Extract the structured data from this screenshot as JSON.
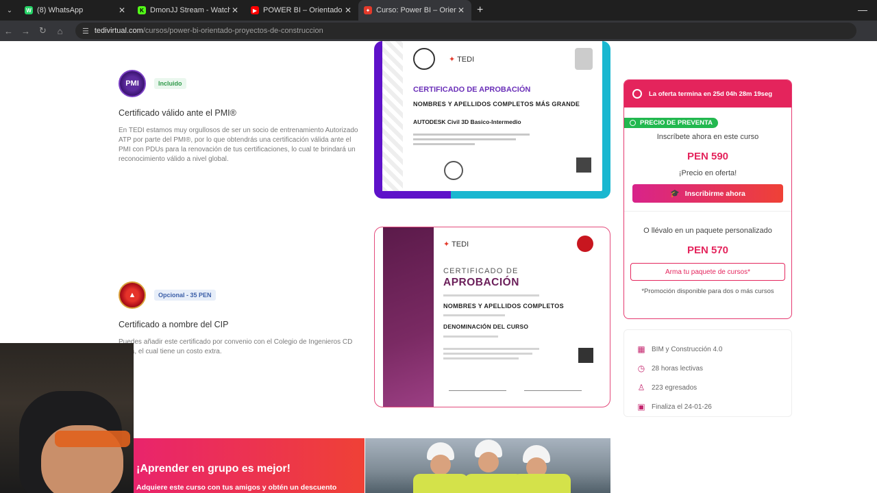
{
  "browser": {
    "tabs": [
      {
        "title": "(8) WhatsApp",
        "color": "#25d366",
        "glyph": "W"
      },
      {
        "title": "DmonJJ Stream - Watch Live on",
        "color": "#53fc18",
        "glyph": "K"
      },
      {
        "title": "POWER BI – Orientado a proyec",
        "color": "#ff0000",
        "glyph": "▶"
      },
      {
        "title": "Curso: Power BI – Orientado a p",
        "color": "#e33a2b",
        "glyph": "✦"
      }
    ],
    "url_domain": "tedivirtual.com",
    "url_path": "/cursos/power-bi-orientado-proyectos-de-construccion"
  },
  "sections": {
    "pmi": {
      "badge": "Incluido",
      "title": "Certificado válido ante el PMI®",
      "text": "En TEDI estamos muy orgullosos de ser un socio de entrenamiento Autorizado ATP por parte del PMI®, por lo que obtendrás una certificación válida ante el PMI con PDUs para la renovación de tus certificaciones, lo cual te brindará un reconocimiento válido a nivel global."
    },
    "cip": {
      "badge": "Opcional - 35 PEN",
      "title": "Certificado a nombre del CIP",
      "text": "Puedes añadir este certificado por convenio con el Colegio de Ingenieros CD Piura, el cual tiene un costo extra."
    }
  },
  "cert1": {
    "tedi": "TEDI",
    "heading": "CERTIFICADO DE APROBACIÓN",
    "name": "NOMBRES Y APELLIDOS COMPLETOS MÁS GRANDE",
    "course": "AUTODESK Civil 3D Basico-Intermedio"
  },
  "cert2": {
    "tedi": "TEDI",
    "heading1": "CERTIFICADO DE",
    "heading2": "APROBACIÓN",
    "name": "NOMBRES Y APELLIDOS COMPLETOS",
    "course": "DENOMINACIÓN DEL CURSO"
  },
  "offer": {
    "countdown": "La oferta termina en 25d 04h 28m 19seg",
    "presale": "PRECIO DE PREVENTA",
    "enroll_text": "Inscríbete ahora en este curso",
    "price": "PEN 590",
    "offer_text": "¡Precio en oferta!",
    "enroll_button": "Inscribirme ahora",
    "package_text": "O llévalo en un paquete personalizado",
    "package_price": "PEN 570",
    "package_button": "Arma tu paquete de cursos*",
    "promo_note": "*Promoción disponible para dos o más cursos"
  },
  "info": {
    "items": [
      {
        "icon": "building-icon",
        "label": "BIM y Construcción 4.0"
      },
      {
        "icon": "clock-icon",
        "label": "28 horas lectivas"
      },
      {
        "icon": "graduate-icon",
        "label": "223 egresados"
      },
      {
        "icon": "calendar-icon",
        "label": "Finaliza el 24-01-26"
      }
    ]
  },
  "banner": {
    "title": "¡Aprender en grupo es mejor!",
    "subtitle": "Adquiere este curso con tus amigos y obtén un descuento"
  },
  "colors": {
    "accent": "#e4245c",
    "presale_green": "#22b84f",
    "pmi_purple": "#5e12c9"
  }
}
